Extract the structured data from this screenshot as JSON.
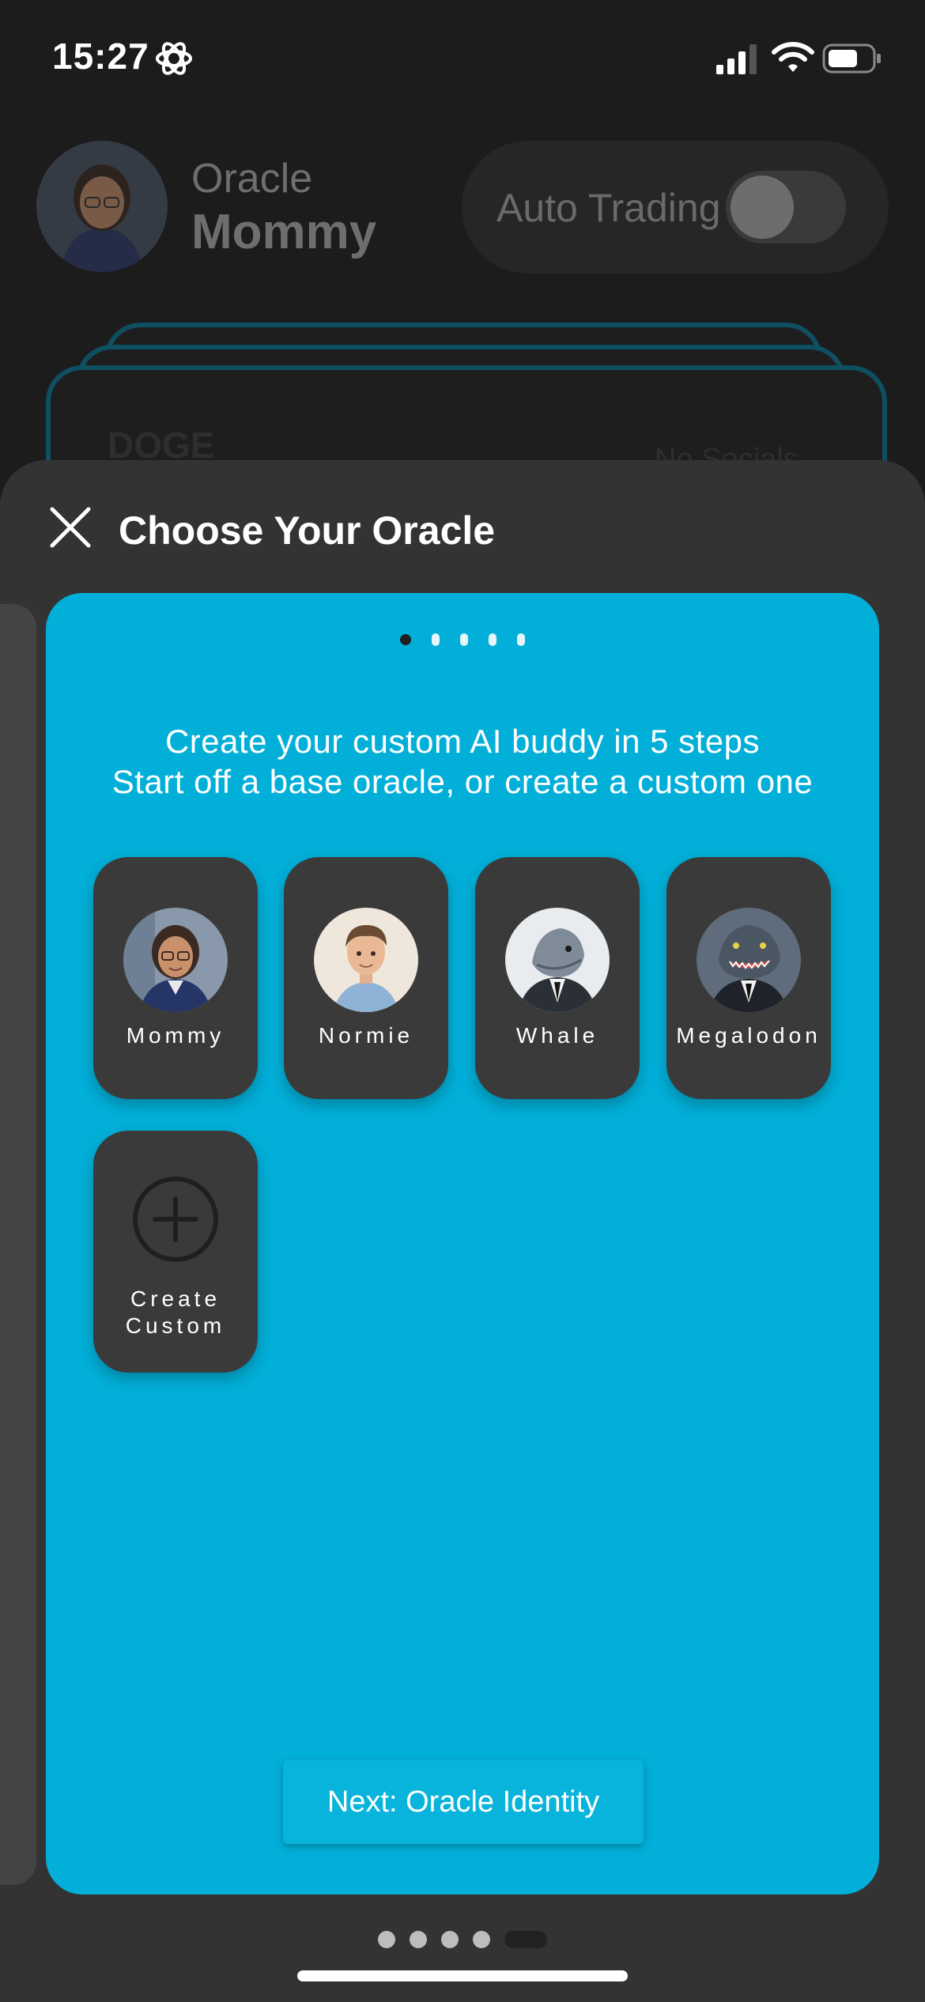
{
  "status_bar": {
    "time": "15:27"
  },
  "header": {
    "oracle_label": "Oracle",
    "oracle_name": "Mommy",
    "auto_trading_label": "Auto Trading",
    "auto_trading_on": false
  },
  "background_card": {
    "ticker": "DOGE",
    "socials": "No Socials"
  },
  "sheet": {
    "title": "Choose Your Oracle",
    "step_dots": {
      "total": 5,
      "active": 1
    },
    "intro_line1": "Create your custom AI buddy in 5 steps",
    "intro_line2": "Start off a base oracle, or create a custom one",
    "oracles": [
      {
        "name": "Mommy",
        "avatar": "mommy-avatar"
      },
      {
        "name": "Normie",
        "avatar": "normie-avatar"
      },
      {
        "name": "Whale",
        "avatar": "whale-avatar"
      },
      {
        "name": "Megalodon",
        "avatar": "megalodon-avatar"
      }
    ],
    "custom_tile": {
      "line1": "Create",
      "line2": "Custom",
      "icon": "plus-circle-icon"
    },
    "next_button": "Next: Oracle Identity"
  },
  "pager": {
    "total": 5,
    "active": 5
  },
  "colors": {
    "accent": "#02afd8",
    "sheet_bg": "#333333",
    "tile_bg": "#3a3a3a"
  }
}
